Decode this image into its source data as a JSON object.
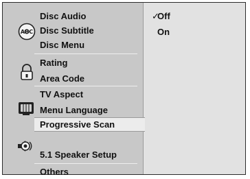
{
  "menu": {
    "groups": [
      {
        "icon": "disc-abc-icon",
        "items": [
          "Disc Audio",
          "Disc Subtitle",
          "Disc Menu"
        ]
      },
      {
        "icon": "padlock-icon",
        "items": [
          "Rating",
          "Area Code"
        ]
      },
      {
        "icon": "tv-screen-icon",
        "items": [
          "TV Aspect",
          "Menu Language",
          "Progressive Scan"
        ]
      },
      {
        "icon": "speaker-icon",
        "items": [
          "5.1 Speaker Setup"
        ]
      },
      {
        "icon": null,
        "items": [
          "Others"
        ]
      }
    ],
    "selected_item": "Progressive Scan"
  },
  "options": [
    {
      "label": "Off",
      "checked": true,
      "check_mark": "✓"
    },
    {
      "label": "On",
      "checked": false,
      "check_mark": ""
    }
  ]
}
